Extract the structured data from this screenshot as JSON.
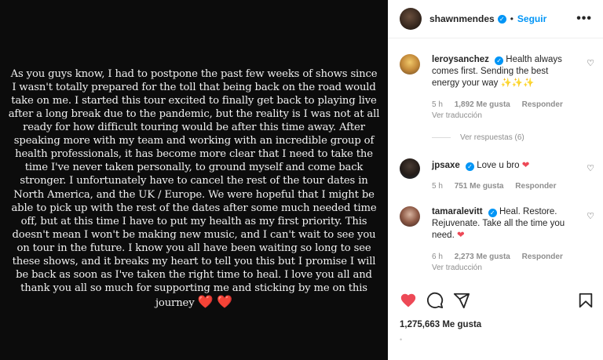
{
  "post": {
    "text": "As you guys know, I had to postpone the past few weeks of shows since I wasn't totally prepared for the toll that being back on the road would take on me. I started this tour excited to finally get back to playing live after a long break due to the pandemic, but the reality is I was not at all ready for how difficult touring would be after this time away. After speaking more with my team and working with an incredible group of health professionals, it has become more clear that I need to take the time I've never taken personally, to ground myself and come back stronger. I unfortunately have to cancel the rest of the tour dates in North America, and the UK / Europe. We were hopeful that I might be able to pick up with the rest of the dates after some much needed time off, but at this time I have to put my health as my first priority. This doesn't mean I won't be making new music, and I can't wait to see you on tour in the future. I know you all have been waiting so long to see these shows, and it breaks my heart to tell you this but I promise I will be back as soon as I've taken the right time to heal. I love you all and thank you all so much for supporting me and sticking by me on this journey",
    "hearts": "❤️ ❤️"
  },
  "header": {
    "username": "shawnmendes",
    "separator": "•",
    "follow_label": "Seguir",
    "more_label": "•••"
  },
  "comments": [
    {
      "username": "leroysanchez",
      "text": "Health always comes first. Sending the best energy your way",
      "emoji": "✨✨✨",
      "time": "5 h",
      "likes": "1,892 Me gusta",
      "reply": "Responder",
      "translate": "Ver traducción",
      "view_replies": "Ver respuestas (6)"
    },
    {
      "username": "jpsaxe",
      "text": "Love u bro",
      "emoji": "❤",
      "time": "5 h",
      "likes": "751 Me gusta",
      "reply": "Responder"
    },
    {
      "username": "tamaralevitt",
      "text": "Heal. Restore. Rejuvenate. Take all the time you need.",
      "emoji": "❤",
      "time": "6 h",
      "likes": "2,273 Me gusta",
      "reply": "Responder",
      "translate": "Ver traducción"
    }
  ],
  "footer": {
    "likes_count": "1,275,663 Me gusta",
    "dot": "•"
  },
  "icons": {
    "like": "heart-filled-icon",
    "comment": "comment-bubble-icon",
    "share": "paper-plane-icon",
    "save": "bookmark-icon"
  },
  "colors": {
    "accent": "#0095f6",
    "like_red": "#ed4956",
    "post_background": "#0c0c0c"
  }
}
